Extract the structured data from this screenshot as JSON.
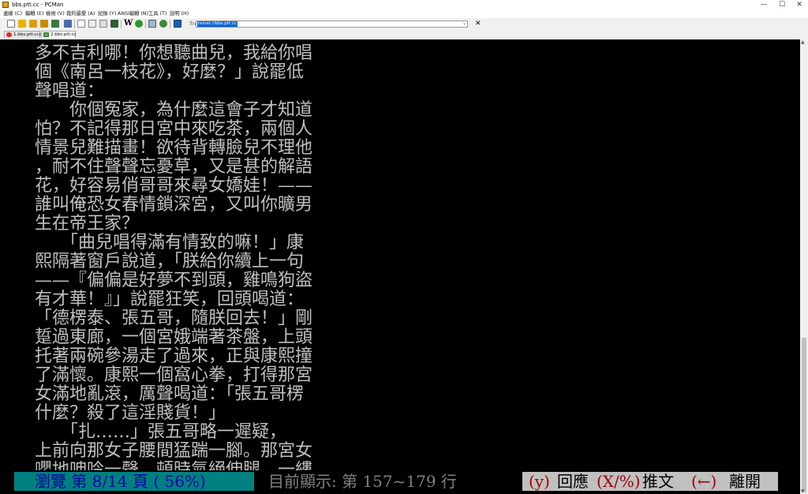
{
  "window": {
    "title": "bbs.ptt.cc - PCMan",
    "minimize": "—",
    "maximize": "☐",
    "close": "✕"
  },
  "menu": [
    "連線 (C)",
    "編輯 (E)",
    "檢視 (V)",
    "我的最愛 (A)",
    "紀錄 (Y)",
    "ANSI編輯 (N)",
    "工具 (T)",
    "說明 (H)"
  ],
  "address": {
    "label": "Tn",
    "value": "telnet://bbs.ptt.cc"
  },
  "close_tab_glyph": "✕",
  "tabs": [
    {
      "label": "1.bbs.ptt.ccc",
      "active": false
    },
    {
      "label": "2.bbs.ptt.cc",
      "active": true
    }
  ],
  "terminal": {
    "lines": [
      "多不吉利哪！你想聽曲兒，我給你唱",
      "個《南呂一枝花》，好麼？」說罷低",
      "聲唱道：",
      "　　你個冤家，為什麼這會子才知道",
      "怕？不記得那日宮中來吃茶，兩個人",
      "情景兒難描畫！欲待背轉臉兒不理他",
      "，耐不住聲聲忘憂草，又是甚的解語",
      "花，好容易俏哥哥來尋女嬌娃！——",
      "誰叫俺恐女春情鎖深宮，又叫你曠男",
      "生在帝王家？",
      "　　「曲兒唱得滿有情致的嘛！」康",
      "熙隔著窗戶說道，「朕給你續上一句",
      "——『偏偏是好夢不到頭，雞鳴狗盜",
      "有才華！』」說罷狂笑，回頭喝道：",
      "「德楞泰、張五哥，隨朕回去！」剛",
      "踅過東廊，一個宮娥端著茶盤，上頭",
      "托著兩碗參湯走了過來，正與康熙撞",
      "了滿懷。康熙一個窩心拳，打得那宮",
      "女滿地亂滾，厲聲喝道：「張五哥楞",
      "什麼？殺了這淫賤貨！」",
      "　　「扎……」張五哥略一遲疑，",
      "上前向那女子腰間猛踹一腳。那宮女",
      "嚶地呻吟一聲，頓時氣絕伸腿，一縷"
    ]
  },
  "status": {
    "browse": "瀏覽 第 8/14 頁 ( 56%)",
    "range": "目前顯示: 第 157~179 行",
    "y_key": "(y)",
    "y_label": "回應",
    "x_key": "(X/%)",
    "x_label": "推文",
    "back_key": "(←)",
    "back_label": "離開"
  },
  "colors": {
    "terminal_bg": "#000000",
    "terminal_text": "#c0c0c0",
    "status_browse_bg": "#008080",
    "status_browse_fg": "#0000a8",
    "status_range_bg": "#000000",
    "status_range_fg": "#808080",
    "status_keys_bg": "#c0c0c0",
    "status_key_fg": "#a00000",
    "status_label_fg": "#000000"
  }
}
